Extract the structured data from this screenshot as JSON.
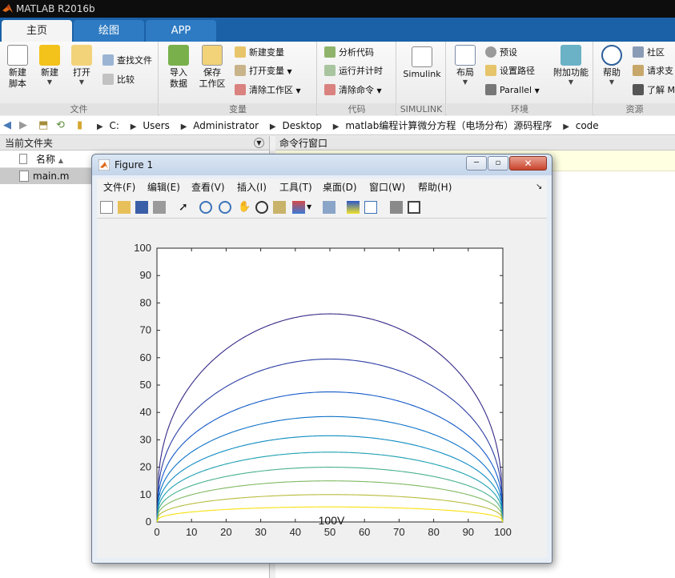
{
  "app": {
    "title": "MATLAB R2016b"
  },
  "tabs": [
    {
      "label": "主页"
    },
    {
      "label": "绘图"
    },
    {
      "label": "APP"
    }
  ],
  "ribbon": {
    "groups": [
      {
        "label": "文件"
      },
      {
        "label": "变量"
      },
      {
        "label": "代码"
      },
      {
        "label": "SIMULINK"
      },
      {
        "label": "环境"
      },
      {
        "label": "资源"
      }
    ],
    "file": {
      "new_script": "新建\n脚本",
      "new": "新建",
      "open": "打开",
      "find_files": "查找文件",
      "compare": "比较"
    },
    "variable": {
      "import": "导入\n数据",
      "save": "保存\n工作区",
      "new_var": "新建变量",
      "open_var": "打开变量",
      "clear_ws": "清除工作区"
    },
    "code": {
      "analyze": "分析代码",
      "run_time": "运行并计时",
      "clear_cmd": "清除命令"
    },
    "simulink": {
      "label": "Simulink"
    },
    "env": {
      "layout": "布局",
      "prefs": "预设",
      "set_path": "设置路径",
      "parallel": "Parallel",
      "addons": "附加功能"
    },
    "res": {
      "help": "帮助",
      "community": "社区",
      "request": "请求支",
      "learn": "了解 M"
    }
  },
  "address": {
    "crumbs": [
      "C:",
      "Users",
      "Administrator",
      "Desktop",
      "matlab编程计算微分方程（电场分布）源码程序",
      "code"
    ]
  },
  "left_panel": {
    "title": "当前文件夹",
    "col_name": "名称",
    "file": "main.m"
  },
  "cmd_panel": {
    "title": "命令行窗口"
  },
  "figure": {
    "title": "Figure 1",
    "menu": [
      "文件(F)",
      "编辑(E)",
      "查看(V)",
      "插入(I)",
      "工具(T)",
      "桌面(D)",
      "窗口(W)",
      "帮助(H)"
    ]
  },
  "chart_data": {
    "type": "line",
    "title": "",
    "xlabel": "",
    "ylabel": "",
    "xlim": [
      0,
      100
    ],
    "ylim": [
      0,
      100
    ],
    "xticks": [
      0,
      10,
      20,
      30,
      40,
      50,
      60,
      70,
      80,
      90,
      100
    ],
    "yticks": [
      0,
      10,
      20,
      30,
      40,
      50,
      60,
      70,
      80,
      90,
      100
    ],
    "annotation": "100V",
    "grid": false,
    "series": [
      {
        "peak": 76,
        "color": "#352a87"
      },
      {
        "peak": 59.5,
        "color": "#2c3ea3"
      },
      {
        "peak": 47.5,
        "color": "#1258c8"
      },
      {
        "peak": 38.5,
        "color": "#0d72c8"
      },
      {
        "peak": 31.5,
        "color": "#0f8cc1"
      },
      {
        "peak": 25.5,
        "color": "#1da0b0"
      },
      {
        "peak": 20,
        "color": "#47b08c"
      },
      {
        "peak": 15,
        "color": "#7fb961"
      },
      {
        "peak": 10,
        "color": "#b7bc3d"
      },
      {
        "peak": 5.5,
        "color": "#f8e00f"
      }
    ]
  }
}
